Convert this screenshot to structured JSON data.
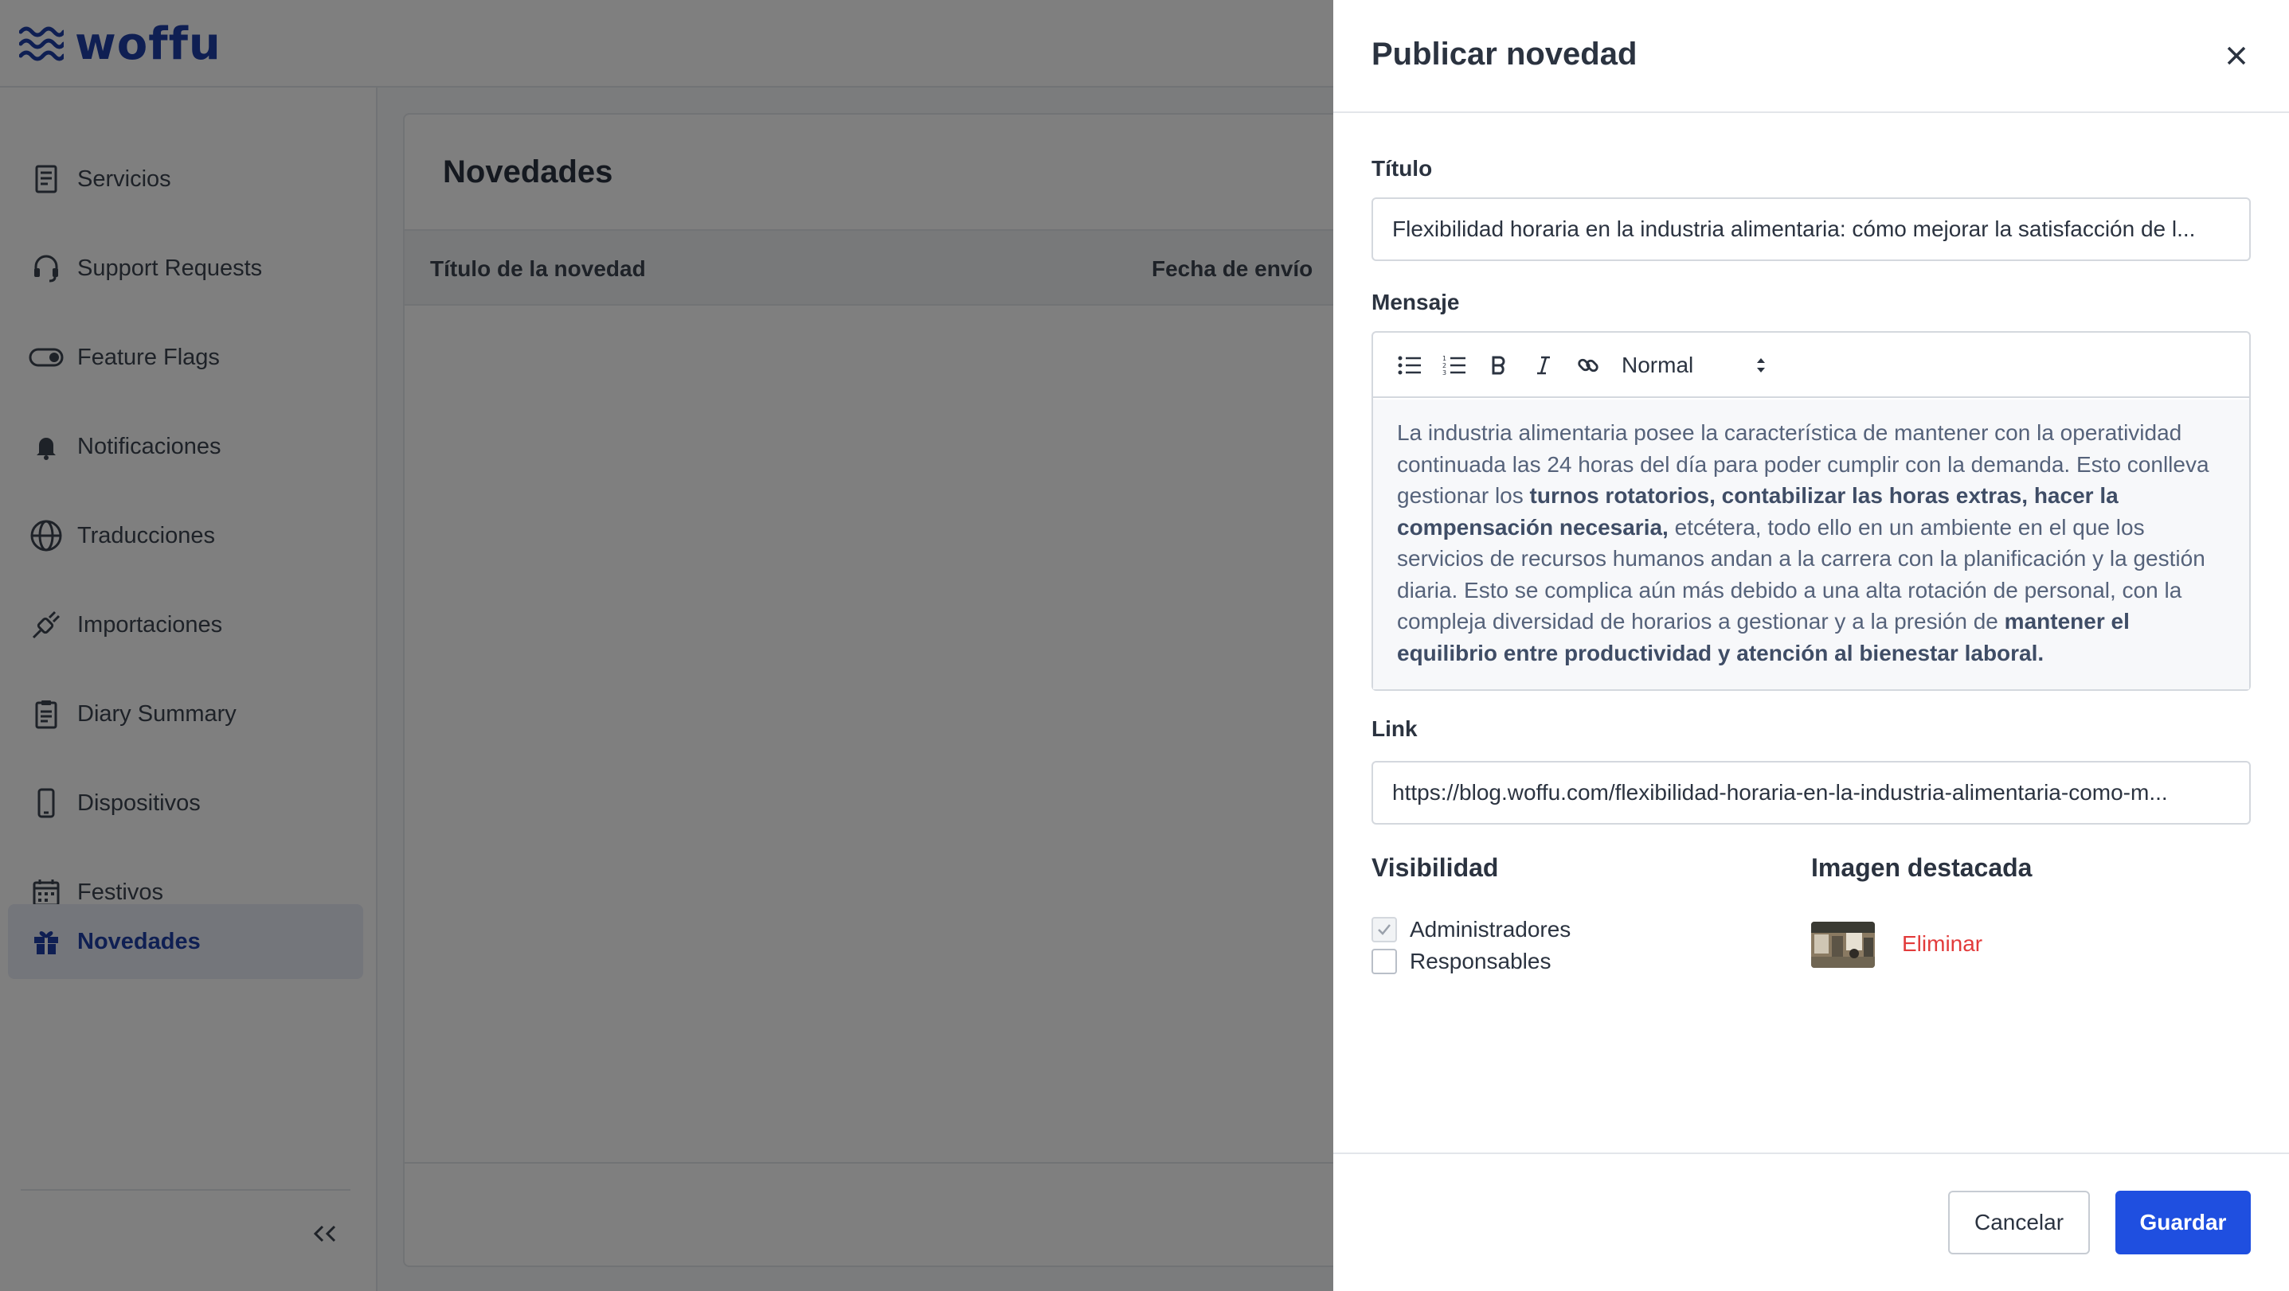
{
  "app": {
    "brand": "woffu"
  },
  "sidebar": {
    "items": [
      {
        "label": "Servicios",
        "icon": "receipt-icon"
      },
      {
        "label": "Support Requests",
        "icon": "headset-icon"
      },
      {
        "label": "Feature Flags",
        "icon": "toggle-icon"
      },
      {
        "label": "Notificaciones",
        "icon": "bell-icon"
      },
      {
        "label": "Traducciones",
        "icon": "globe-icon"
      },
      {
        "label": "Importaciones",
        "icon": "plug-icon"
      },
      {
        "label": "Diary Summary",
        "icon": "clipboard-icon"
      },
      {
        "label": "Dispositivos",
        "icon": "phone-icon"
      },
      {
        "label": "Festivos",
        "icon": "calendar-icon"
      },
      {
        "label": "Novedades",
        "icon": "gift-icon",
        "active": true
      }
    ],
    "collapse_label": "<<"
  },
  "main": {
    "title": "Novedades",
    "columns": [
      "Título de la novedad",
      "Fecha de envío"
    ]
  },
  "drawer": {
    "title": "Publicar novedad",
    "title_field": {
      "label": "Título",
      "value": "Flexibilidad horaria en la industria alimentaria: cómo mejorar la satisfacción de l..."
    },
    "message_field": {
      "label": "Mensaje",
      "format_select": "Normal",
      "body": {
        "p1": "La industria alimentaria posee la característica de mantener con la operatividad continuada las 24 horas del día para poder cumplir con la demanda. Esto conlleva gestionar los ",
        "b1": "turnos rotatorios, contabilizar las horas extras, hacer la compensación necesaria,",
        "p2": " etcétera, todo ello en un ambiente en el que los servicios de recursos humanos andan a la carrera con la planificación y la gestión diaria. Esto se complica aún más debido a una alta rotación de personal, con la compleja diversidad de horarios a gestionar y a la presión de ",
        "b2": "mantener el equilibrio entre productividad y atención al bienestar laboral."
      }
    },
    "link_field": {
      "label": "Link",
      "value": "https://blog.woffu.com/flexibilidad-horaria-en-la-industria-alimentaria-como-m..."
    },
    "visibility": {
      "label": "Visibilidad",
      "options": [
        {
          "label": "Administradores",
          "checked": true,
          "disabled": true
        },
        {
          "label": "Responsables",
          "checked": false
        }
      ]
    },
    "featured_image": {
      "label": "Imagen destacada",
      "remove_label": "Eliminar"
    },
    "buttons": {
      "cancel": "Cancelar",
      "save": "Guardar"
    }
  },
  "colors": {
    "brand": "#1e3fa6",
    "primary_button": "#1f4fe0",
    "danger": "#e23b3b",
    "overlay": "rgba(0,0,0,0.5)"
  }
}
